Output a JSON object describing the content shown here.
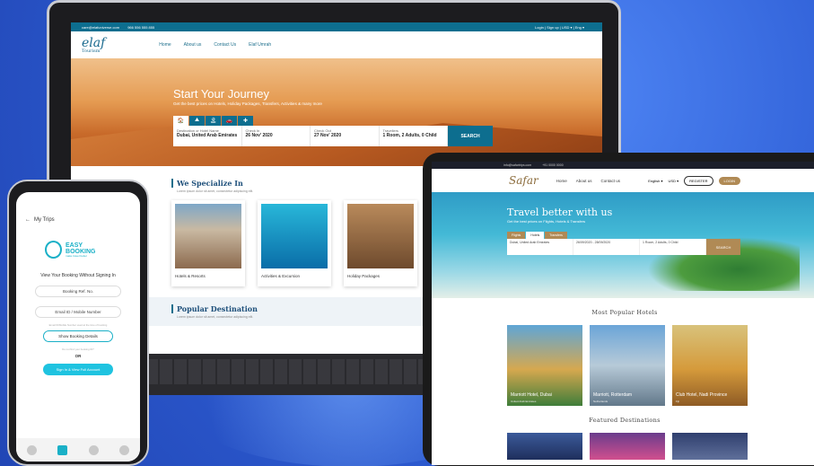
{
  "laptop": {
    "topbar": {
      "email": "care@elafuniverse.com",
      "phone": "966 556 555 855",
      "links": "Login  |  Sign up  |  USD ▾ |  Eng ▾"
    },
    "logo": {
      "name": "elaf",
      "sub": "Tourism"
    },
    "nav": [
      "Home",
      "About us",
      "Contact Us",
      "Elaf Umrah"
    ],
    "hero_title": "Start Your Journey",
    "hero_sub": "Get the best prices on Hotels, Holiday Packages, Transfers, Activities & many more",
    "tabs": [
      "🏠",
      "⛰",
      "🏝",
      "🚗",
      "✚"
    ],
    "fields": [
      {
        "label": "Destination or Hotel Name",
        "value": "Dubai, United Arab Emirates"
      },
      {
        "label": "Check In",
        "value": "26 Nov' 2020"
      },
      {
        "label": "Check Out",
        "value": "27 Nov' 2020"
      },
      {
        "label": "Travellers",
        "value": "1 Room, 2 Adults, 0 Child"
      }
    ],
    "search_btn": "SEARCH",
    "specialize_title": "We Specialize In",
    "specialize_text": "Lorem ipsum dolor sit amet, consectetur adipiscing elit.",
    "cards": [
      "Hotels & Resorts",
      "Activities & Excursion",
      "Holiday Packages"
    ],
    "popular_title": "Popular Destination",
    "popular_text": "Lorem ipsum dolor sit amet, consectetur adipiscing elit."
  },
  "tablet": {
    "topbar": [
      "info@safartrips.com",
      "+91 0000 0000"
    ],
    "logo": "Safar",
    "nav": [
      "Home",
      "About us",
      "Contact us"
    ],
    "right": [
      "English ▾",
      "USD ▾"
    ],
    "register": "REGISTER",
    "login": "LOGIN",
    "hero_title": "Travel better with us",
    "hero_sub": "Get the best prices on Flights, Hotels & Transfers",
    "tabs": [
      "Flights",
      "Hotels",
      "Transfers"
    ],
    "fields": [
      "Dubai, United Arab Emirates",
      "26/09/2020 - 28/09/2020",
      "1 Room, 2 Adults, 0 Child"
    ],
    "search_btn": "SEARCH",
    "hotels_title": "Most Popular Hotels",
    "hotels": [
      {
        "name": "Marriott Hotel, Dubai",
        "loc": "United Arab Emirates"
      },
      {
        "name": "Marriott, Rotterdam",
        "loc": "Netherlands"
      },
      {
        "name": "Club Hotel, Nadi Province",
        "loc": "Fiji"
      }
    ],
    "dest_title": "Featured Destinations"
  },
  "phone": {
    "back_title": "My Trips",
    "logo_name": "EASY BOOKING",
    "logo_sub": "make travel better",
    "title": "View Your Booking Without Signing In",
    "ref_placeholder": "Booking Ref. No.",
    "email_placeholder": "Email ID / Mobile Number",
    "note": "Email ID/Mobile Number used at the time of booking",
    "show_btn": "Show Booking Details",
    "note2": "Do not find your booking ID?",
    "or": "OR",
    "sign_btn": "Sign In & View Full Account"
  }
}
